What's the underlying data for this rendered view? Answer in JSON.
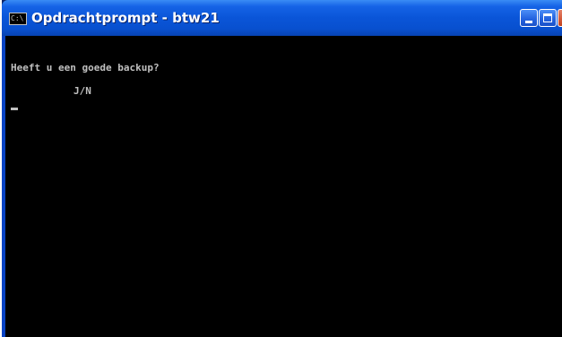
{
  "window": {
    "title": "Opdrachtprompt - btw21",
    "icon": "console-icon",
    "icon_glyph": "C:\\",
    "controls": {
      "minimize": "minimize-icon",
      "maximize": "maximize-icon",
      "close_glyph": "×"
    }
  },
  "console": {
    "lines": [
      "Heeft u een goede backup?",
      "J/N"
    ],
    "text_color": "#c0c0c0",
    "background": "#000000"
  },
  "colors": {
    "titlebar": "#0a55d8",
    "close_button": "#d45a3c"
  }
}
